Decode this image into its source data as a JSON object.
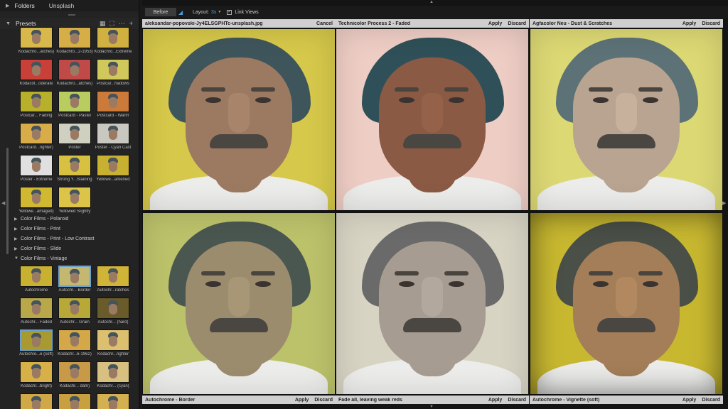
{
  "sidebar": {
    "folders_label": "Folders",
    "folders_sub": "Unsplash",
    "presets_label": "Presets",
    "tools": [
      "grid-view-icon",
      "fit-icon",
      "more-icon",
      "add-icon"
    ],
    "thumbs_top": [
      {
        "label": "Kodachro...atches)",
        "tint": "#d8b84a"
      },
      {
        "label": "Kodachro...2-1953)",
        "tint": "#d6ae48"
      },
      {
        "label": "Kodachro...Extreme",
        "tint": "#d0b040"
      },
      {
        "label": "Kodacol...oderate",
        "tint": "#c84038"
      },
      {
        "label": "Kodachro...atches)",
        "tint": "#c04a48"
      },
      {
        "label": "Postcar...hadows",
        "tint": "#d0c85a"
      },
      {
        "label": "Postcar... Fading",
        "tint": "#b8b02a"
      },
      {
        "label": "Postcard - Pastel",
        "tint": "#b8cc60"
      },
      {
        "label": "Postcard - Warm",
        "tint": "#cc7a3a"
      },
      {
        "label": "Postcard...righter)",
        "tint": "#d8ac48"
      },
      {
        "label": "Poster",
        "tint": "#d0d0c0"
      },
      {
        "label": "Poster - Cyan Cast",
        "tint": "#c8c8c0"
      },
      {
        "label": "Poster - Extreme",
        "tint": "#e0e0e0"
      },
      {
        "label": "Strong Y...Staining",
        "tint": "#d8c040"
      },
      {
        "label": "Yellowe...arkened",
        "tint": "#c8b030"
      },
      {
        "label": "Yellowe...amaged)",
        "tint": "#d0b830"
      },
      {
        "label": "Yellowed Slightly",
        "tint": "#dcc448"
      }
    ],
    "categories": [
      {
        "label": "Color Films - Polaroid",
        "open": false
      },
      {
        "label": "Color Films - Print",
        "open": false
      },
      {
        "label": "Color Films - Print - Low Contrast",
        "open": false
      },
      {
        "label": "Color Films - Slide",
        "open": false
      },
      {
        "label": "Color Films - Vintage",
        "open": true
      }
    ],
    "thumbs_vintage": [
      {
        "label": "Autochrome",
        "tint": "#c8b030",
        "sel": false
      },
      {
        "label": "Autochr... Border",
        "tint": "#c4b870",
        "sel": true
      },
      {
        "label": "Autochr...ratches",
        "tint": "#d0b438",
        "sel": false
      },
      {
        "label": "Autochr... Faded",
        "tint": "#b8a84a",
        "sel": false
      },
      {
        "label": "Autochr... Grain",
        "tint": "#b8a838",
        "sel": false
      },
      {
        "label": "Autochr... (hard)",
        "tint": "#6a5c2a",
        "sel": false
      },
      {
        "label": "Autochro...e (soft)",
        "tint": "#a89a30",
        "sel": true
      },
      {
        "label": "Kodachr...6-1962)",
        "tint": "#d4a848",
        "sel": false
      },
      {
        "label": "Kodachr...righter",
        "tint": "#dcc070",
        "sel": false
      },
      {
        "label": "Kodachr...bright)",
        "tint": "#d8b048",
        "sel": false
      },
      {
        "label": "Kodachr... dark)",
        "tint": "#c89a48",
        "sel": false
      },
      {
        "label": "Kodachr... (cyan)",
        "tint": "#d8c080",
        "sel": false
      },
      {
        "label": "",
        "tint": "#d0a848",
        "sel": false
      },
      {
        "label": "",
        "tint": "#c8a040",
        "sel": false
      },
      {
        "label": "",
        "tint": "#d4b050",
        "sel": false
      }
    ]
  },
  "toolbar": {
    "before_label": "Before",
    "layout_label": "Layout:",
    "layout_value": "3x",
    "link_label": "Link Views"
  },
  "panels": [
    {
      "title": "aleksandar-popovski-Jy4ELSGPHTc-unsplash.jpg",
      "buttons": [
        "Cancel"
      ],
      "header_pos": "top",
      "bg": "#d6c84a",
      "skin": "#9c7a62",
      "hair": "#3f555c"
    },
    {
      "title": "Technicolor Process 2 - Faded",
      "buttons": [
        "Apply",
        "Discard"
      ],
      "header_pos": "top",
      "bg": "#eecdc4",
      "skin": "#8a5a44",
      "hair": "#2f5058"
    },
    {
      "title": "Agfacolor Neu - Dust & Scratches",
      "buttons": [
        "Apply",
        "Discard"
      ],
      "header_pos": "top",
      "bg": "#dcd874",
      "skin": "#b8a490",
      "hair": "#5c7276"
    },
    {
      "title": "Autochrome - Border",
      "buttons": [
        "Apply",
        "Discard"
      ],
      "header_pos": "bottom",
      "bg": "#bcc26a",
      "skin": "#9c8c6e",
      "hair": "#4a5650"
    },
    {
      "title": "Fade all, leaving weak reds",
      "buttons": [
        "Apply",
        "Discard"
      ],
      "header_pos": "bottom",
      "bg": "#d8d4c4",
      "skin": "#a69c92",
      "hair": "#6a6a6a"
    },
    {
      "title": "Autochrome - Vignette (soft)",
      "buttons": [
        "Apply",
        "Discard"
      ],
      "header_pos": "bottom",
      "bg": "#c8b830",
      "skin": "#a47e58",
      "hair": "#4a5048"
    }
  ]
}
